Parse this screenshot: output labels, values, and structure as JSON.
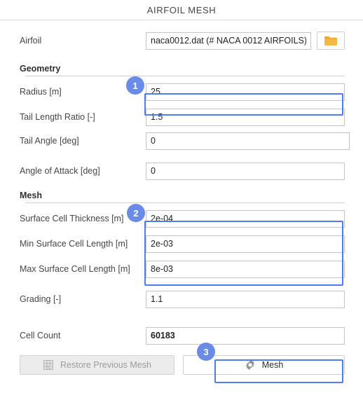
{
  "window": {
    "title": "AIRFOIL MESH"
  },
  "airfoil": {
    "label": "Airfoil",
    "value": "naca0012.dat (# NACA 0012 AIRFOILS)",
    "browse_icon": "folder-icon"
  },
  "geometry": {
    "title": "Geometry",
    "fields": [
      {
        "label": "Radius [m]",
        "value": "25"
      },
      {
        "label": "Tail Length Ratio [-]",
        "value": "1.5"
      },
      {
        "label": "Tail Angle [deg]",
        "value": "0"
      },
      {
        "label": "Angle of Attack [deg]",
        "value": "0"
      }
    ]
  },
  "mesh": {
    "title": "Mesh",
    "fields": [
      {
        "label": "Surface Cell Thickness [m]",
        "value": "2e-04"
      },
      {
        "label": "Min Surface Cell Length [m]",
        "value": "2e-03"
      },
      {
        "label": "Max Surface Cell Length [m]",
        "value": "8e-03"
      },
      {
        "label": "Grading [-]",
        "value": "1.1"
      }
    ]
  },
  "cell_count": {
    "label": "Cell Count",
    "value": "60183"
  },
  "buttons": {
    "restore": {
      "label": "Restore Previous Mesh",
      "icon": "mesh-grid-icon"
    },
    "mesh": {
      "label": "Mesh",
      "icon": "gear-icon"
    }
  },
  "badges": [
    {
      "number": "1"
    },
    {
      "number": "2"
    },
    {
      "number": "3"
    }
  ],
  "colors": {
    "highlight": "#4e7df0",
    "badge": "#6b8be8",
    "folder": "#f0a92a",
    "title_text": "#45474f"
  }
}
